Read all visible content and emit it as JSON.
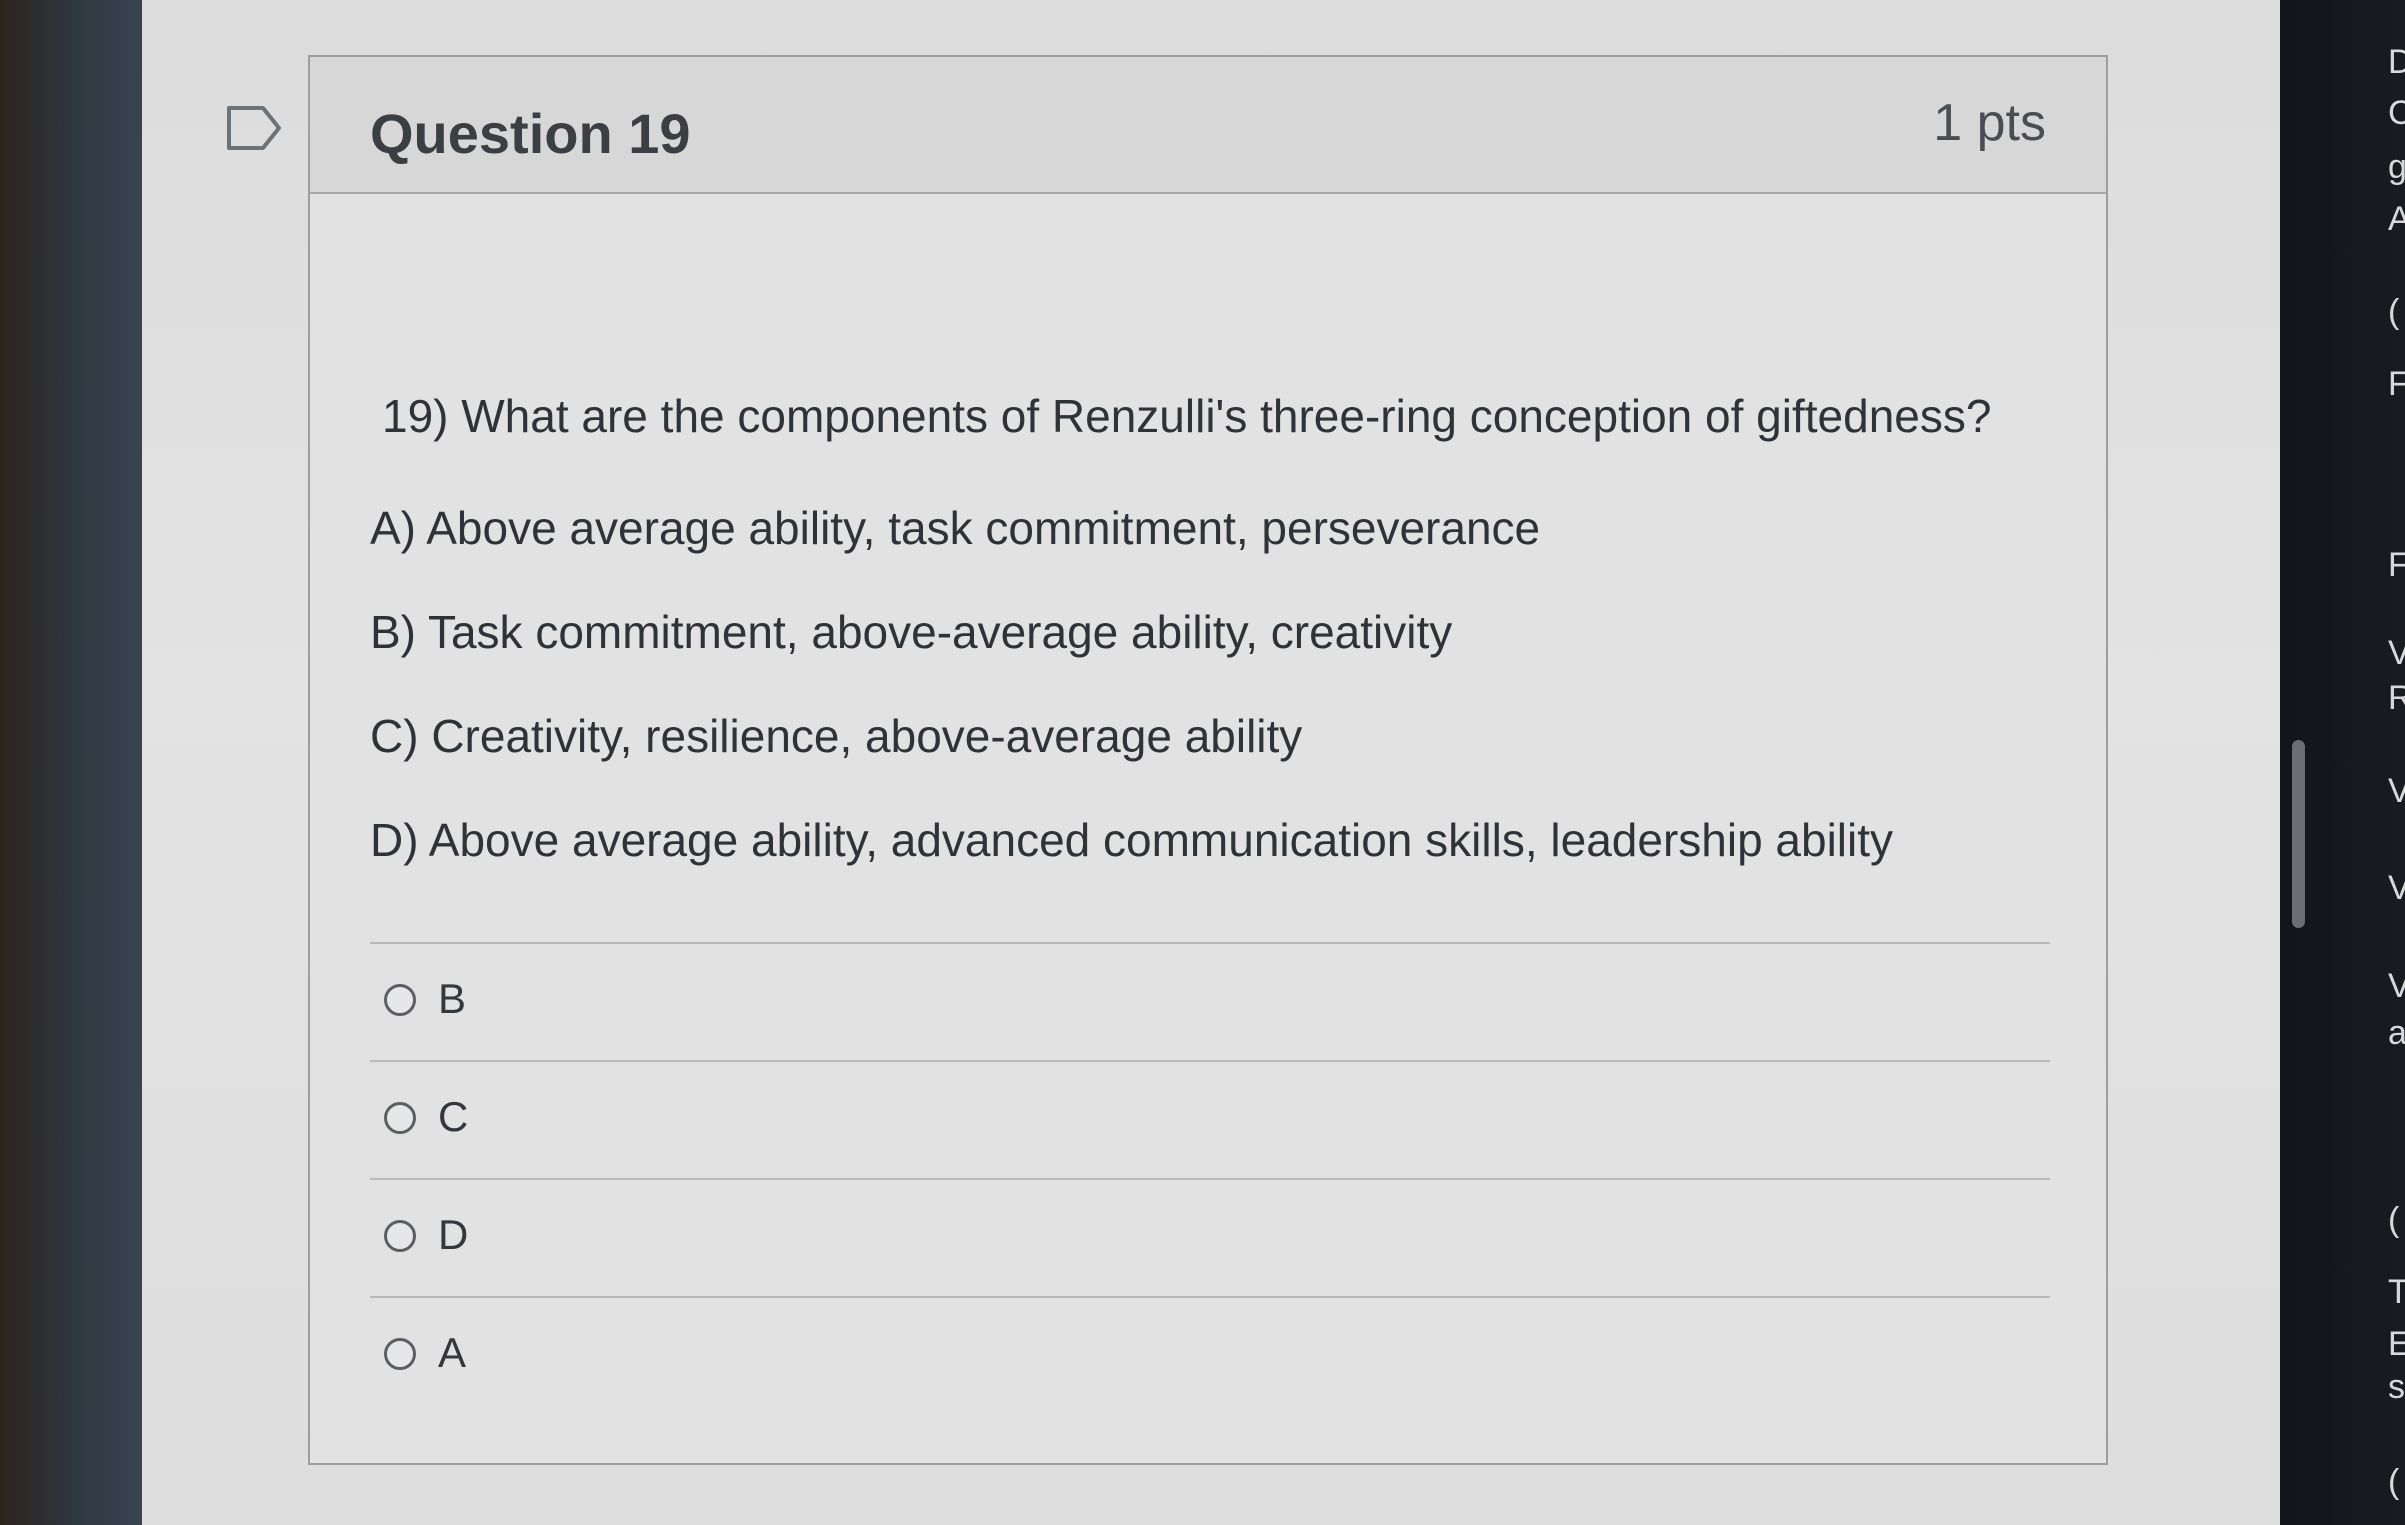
{
  "question": {
    "title": "Question 19",
    "points": "1 pts",
    "text": "19) What are the components of Renzulli's three-ring conception of giftedness?"
  },
  "options": [
    "A) Above average ability, task commitment, perseverance",
    "B) Task commitment, above-average ability, creativity",
    "C) Creativity, resilience, above-average ability",
    "D) Above average ability, advanced communication skills, leadership ability"
  ],
  "answers": [
    "B",
    "C",
    "D",
    "A"
  ],
  "side_letters": [
    "D",
    "C",
    "g",
    "A",
    "(",
    "F",
    "F",
    "V",
    "R",
    "V",
    "V",
    "V",
    "a",
    "(",
    "T",
    "E",
    "s",
    "("
  ],
  "colors": {
    "screen_background": "#e0e0e0",
    "header_background": "#d7d7d7",
    "card_border": "#9e9e9e",
    "text": "#2f3338",
    "radio_border": "#5b5f64"
  },
  "icons": {
    "flag": "flag-icon",
    "radio": "radio-button-icon"
  }
}
